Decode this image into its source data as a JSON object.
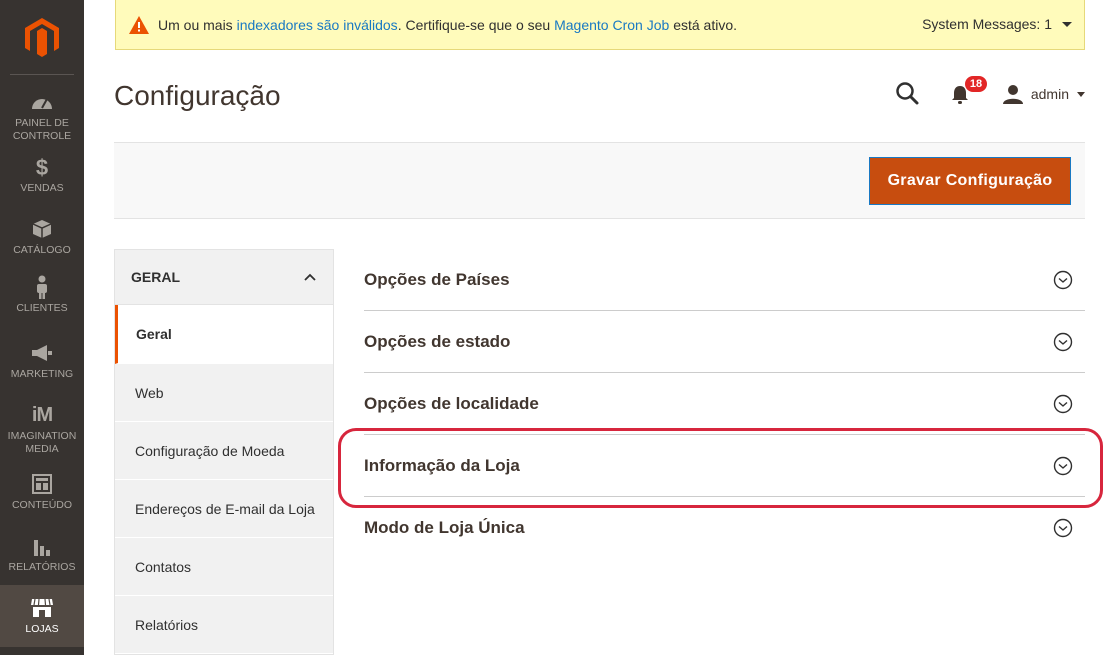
{
  "sidebar": {
    "items": [
      {
        "label": "PAINEL DE CONTROLE",
        "icon": "dashboard-icon"
      },
      {
        "label": "VENDAS",
        "icon": "dollar-icon"
      },
      {
        "label": "CATÁLOGO",
        "icon": "box-icon"
      },
      {
        "label": "CLIENTES",
        "icon": "person-icon"
      },
      {
        "label": "MARKETING",
        "icon": "megaphone-icon"
      },
      {
        "label": "IMAGINATION MEDIA",
        "icon": "im-logo-icon"
      },
      {
        "label": "CONTEÚDO",
        "icon": "layout-icon"
      },
      {
        "label": "RELATÓRIOS",
        "icon": "bar-chart-icon"
      },
      {
        "label": "LOJAS",
        "icon": "store-icon"
      }
    ]
  },
  "system_message": {
    "text_1": "Um ou mais",
    "link_1": "indexadores são inválidos",
    "text_2": ". Certifique-se que o seu",
    "link_2": "Magento Cron Job",
    "text_3": "está ativo.",
    "counter": "System Messages: 1"
  },
  "header": {
    "title": "Configuração",
    "notifications_count": "18",
    "user": "admin"
  },
  "actions": {
    "save_label": "Gravar Configuração"
  },
  "config_nav": {
    "group": "GERAL",
    "items": [
      "Geral",
      "Web",
      "Configuração de Moeda",
      "Endereços de E-mail da Loja",
      "Contatos",
      "Relatórios"
    ]
  },
  "sections": [
    "Opções de Países",
    "Opções de estado",
    "Opções de localidade",
    "Informação da Loja",
    "Modo de Loja Única"
  ],
  "colors": {
    "sidebar_bg": "#373330",
    "accent_orange": "#eb5202",
    "save_button": "#c74d0f",
    "link": "#1979c3",
    "highlight": "#d7263d"
  }
}
